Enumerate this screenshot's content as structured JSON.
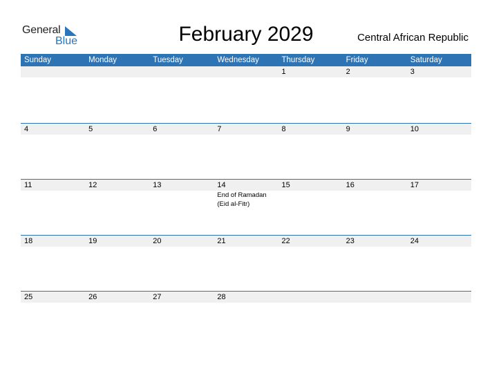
{
  "logo": {
    "word1": "General",
    "word2": "Blue"
  },
  "title": "February 2029",
  "country": "Central African Republic",
  "weekdays": [
    "Sunday",
    "Monday",
    "Tuesday",
    "Wednesday",
    "Thursday",
    "Friday",
    "Saturday"
  ],
  "weeks": [
    [
      {
        "d": ""
      },
      {
        "d": ""
      },
      {
        "d": ""
      },
      {
        "d": ""
      },
      {
        "d": "1"
      },
      {
        "d": "2"
      },
      {
        "d": "3"
      }
    ],
    [
      {
        "d": "4"
      },
      {
        "d": "5"
      },
      {
        "d": "6"
      },
      {
        "d": "7"
      },
      {
        "d": "8"
      },
      {
        "d": "9"
      },
      {
        "d": "10"
      }
    ],
    [
      {
        "d": "11"
      },
      {
        "d": "12"
      },
      {
        "d": "13"
      },
      {
        "d": "14",
        "e": "End of Ramadan (Eid al-Fitr)"
      },
      {
        "d": "15"
      },
      {
        "d": "16"
      },
      {
        "d": "17"
      }
    ],
    [
      {
        "d": "18"
      },
      {
        "d": "19"
      },
      {
        "d": "20"
      },
      {
        "d": "21"
      },
      {
        "d": "22"
      },
      {
        "d": "23"
      },
      {
        "d": "24"
      }
    ],
    [
      {
        "d": "25"
      },
      {
        "d": "26"
      },
      {
        "d": "27"
      },
      {
        "d": "28"
      },
      {
        "d": ""
      },
      {
        "d": ""
      },
      {
        "d": ""
      }
    ]
  ]
}
